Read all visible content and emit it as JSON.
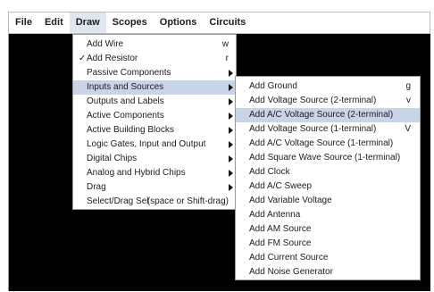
{
  "menubar": {
    "items": [
      "File",
      "Edit",
      "Draw",
      "Scopes",
      "Options",
      "Circuits"
    ],
    "open_index": 2
  },
  "draw_menu": {
    "items": [
      {
        "label": "Add Wire",
        "shortcut": "w",
        "checked": false,
        "submenu": false
      },
      {
        "label": "Add Resistor",
        "shortcut": "r",
        "checked": true,
        "check_glyph": "✓",
        "submenu": false
      },
      {
        "label": "Passive Components",
        "shortcut": "",
        "checked": false,
        "submenu": true
      },
      {
        "label": "Inputs and Sources",
        "shortcut": "",
        "checked": false,
        "submenu": true,
        "highlighted": true
      },
      {
        "label": "Outputs and Labels",
        "shortcut": "",
        "checked": false,
        "submenu": true
      },
      {
        "label": "Active Components",
        "shortcut": "",
        "checked": false,
        "submenu": true
      },
      {
        "label": "Active Building Blocks",
        "shortcut": "",
        "checked": false,
        "submenu": true
      },
      {
        "label": "Logic Gates, Input and Output",
        "shortcut": "",
        "checked": false,
        "submenu": true
      },
      {
        "label": "Digital Chips",
        "shortcut": "",
        "checked": false,
        "submenu": true
      },
      {
        "label": "Analog and Hybrid Chips",
        "shortcut": "",
        "checked": false,
        "submenu": true
      },
      {
        "label": "Drag",
        "shortcut": "",
        "checked": false,
        "submenu": true
      },
      {
        "label": "Select/Drag Sel",
        "shortcut": "(space or Shift-drag)",
        "checked": false,
        "submenu": false
      }
    ]
  },
  "inputs_submenu": {
    "items": [
      {
        "label": "Add Ground",
        "shortcut": "g"
      },
      {
        "label": "Add Voltage Source (2-terminal)",
        "shortcut": "v"
      },
      {
        "label": "Add A/C Voltage Source (2-terminal)",
        "shortcut": "",
        "highlighted": true
      },
      {
        "label": "Add Voltage Source (1-terminal)",
        "shortcut": "V"
      },
      {
        "label": "Add A/C Voltage Source (1-terminal)",
        "shortcut": ""
      },
      {
        "label": "Add Square Wave Source (1-terminal)",
        "shortcut": ""
      },
      {
        "label": "Add Clock",
        "shortcut": ""
      },
      {
        "label": "Add A/C Sweep",
        "shortcut": ""
      },
      {
        "label": "Add Variable Voltage",
        "shortcut": ""
      },
      {
        "label": "Add Antenna",
        "shortcut": ""
      },
      {
        "label": "Add AM Source",
        "shortcut": ""
      },
      {
        "label": "Add FM Source",
        "shortcut": ""
      },
      {
        "label": "Add Current Source",
        "shortcut": ""
      },
      {
        "label": "Add Noise Generator",
        "shortcut": ""
      }
    ]
  },
  "colors": {
    "canvas": "#000000",
    "menu_bg": "#ffffff",
    "highlight": "#c8d4e8"
  }
}
